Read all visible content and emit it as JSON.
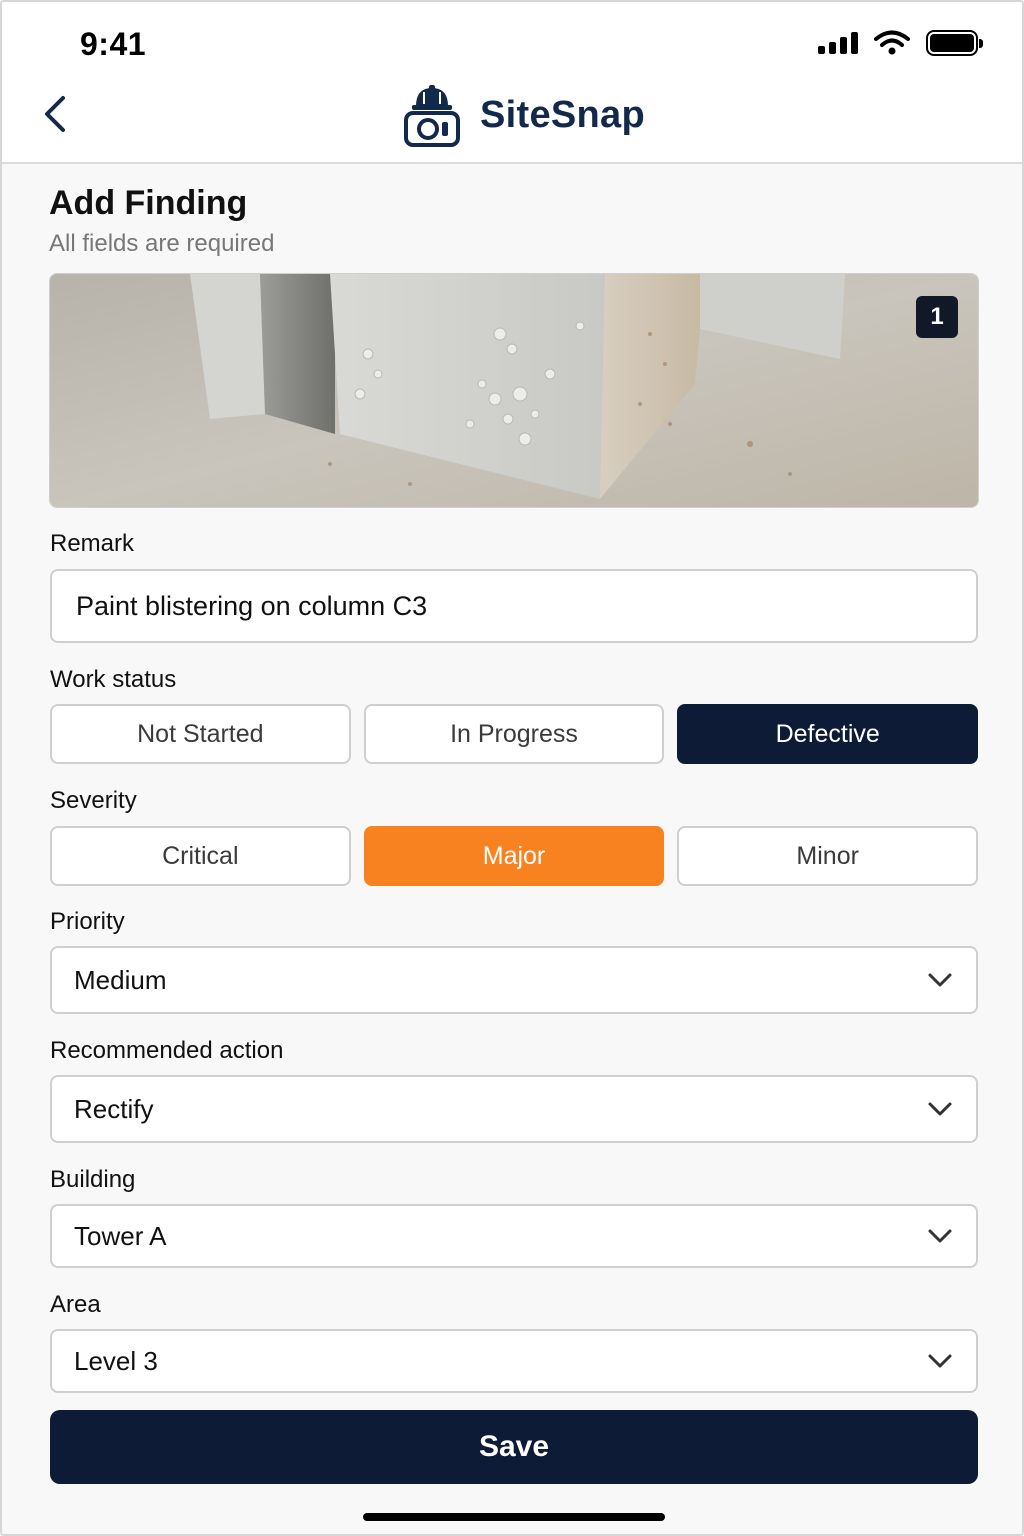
{
  "status_bar": {
    "time": "9:41"
  },
  "header": {
    "app_name": "SiteSnap"
  },
  "page": {
    "title": "Add Finding",
    "subtitle": "All fields are required"
  },
  "photo": {
    "count": "1"
  },
  "remark": {
    "label": "Remark",
    "value": "Paint blistering on column C3"
  },
  "work_status": {
    "label": "Work status",
    "options": [
      "Not Started",
      "In Progress",
      "Defective"
    ],
    "selected": "Defective"
  },
  "severity": {
    "label": "Severity",
    "options": [
      "Critical",
      "Major",
      "Minor"
    ],
    "selected": "Major"
  },
  "priority": {
    "label": "Priority",
    "value": "Medium"
  },
  "recommended_action": {
    "label": "Recommended action",
    "value": "Rectify"
  },
  "building": {
    "label": "Building",
    "value": "Tower A"
  },
  "area": {
    "label": "Area",
    "value": "Level 3"
  },
  "actions": {
    "save_label": "Save"
  },
  "colors": {
    "navy": "#0e1b36",
    "brand": "#13294b",
    "orange": "#f98220"
  },
  "icons": [
    "back-chevron-icon",
    "hardhat-camera-logo-icon",
    "chevron-down-icon",
    "signal-icon",
    "wifi-icon",
    "battery-icon"
  ]
}
